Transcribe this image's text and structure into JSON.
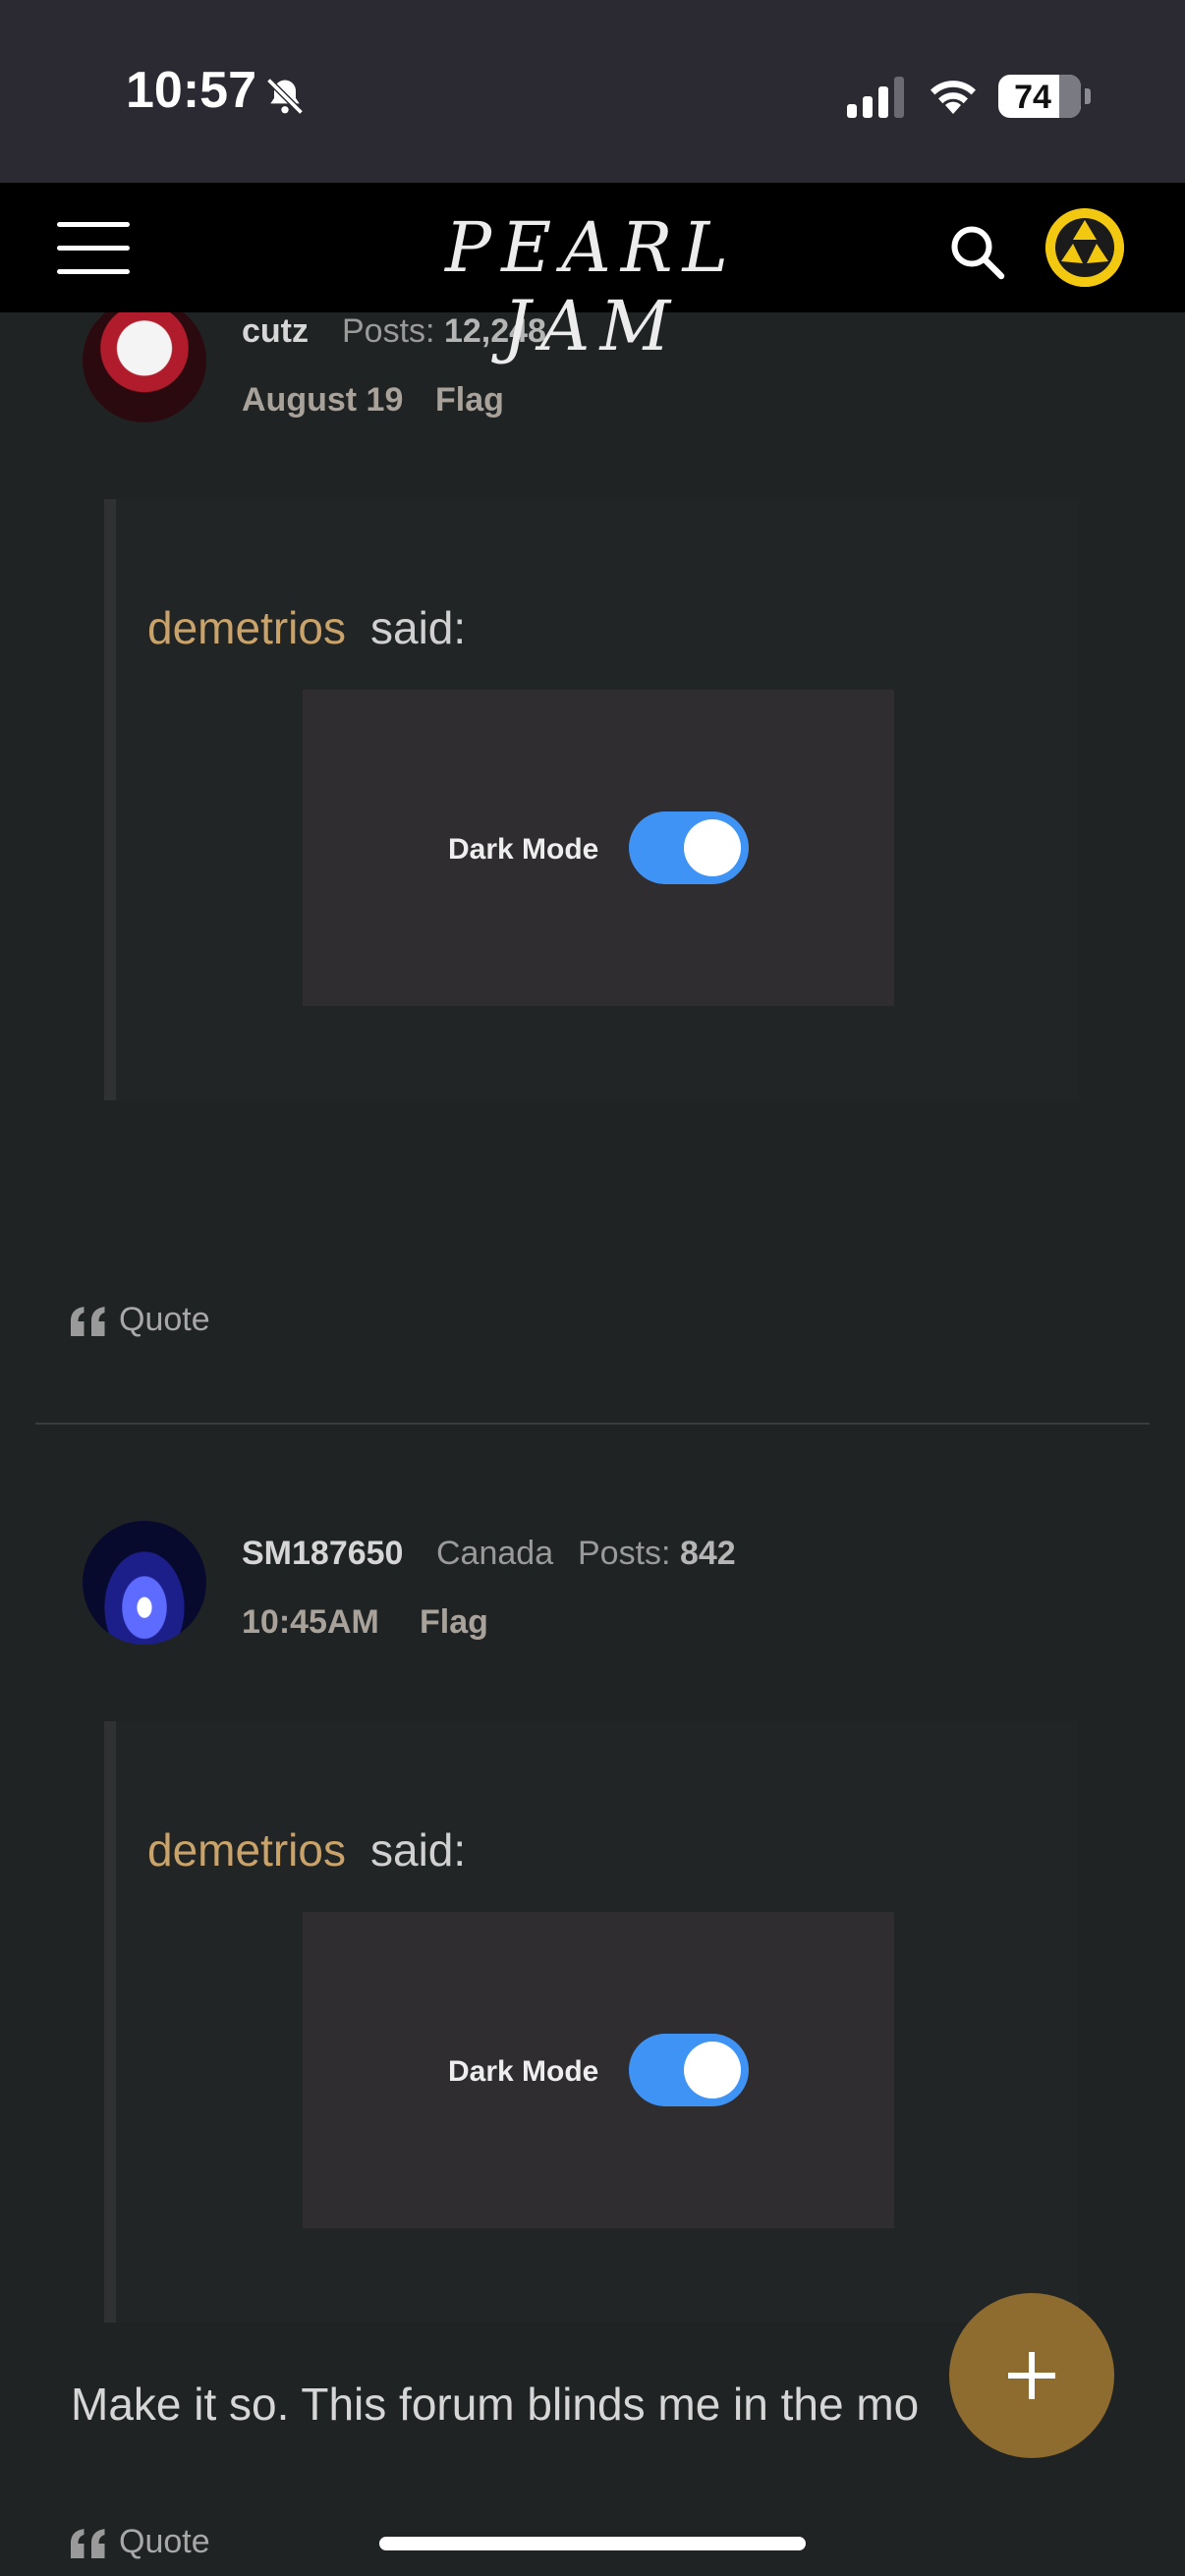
{
  "status_bar": {
    "time": "10:57",
    "battery": "74",
    "icons": [
      "bell-slash-icon",
      "signal-icon",
      "wifi-icon",
      "battery-icon"
    ]
  },
  "header": {
    "logo_text": "PEARL JAM",
    "menu_icon": "hamburger-menu-icon",
    "search_icon": "search-icon",
    "avatar_icon": "record-adapter-icon",
    "avatar_color": "#f2c811"
  },
  "posts": [
    {
      "username": "cutz",
      "location": "",
      "posts_label": "Posts:",
      "posts_count": "12,248",
      "date": "August 19",
      "flag_label": "Flag",
      "quote": {
        "author": "demetrios",
        "said": "said:",
        "image_label": "Dark Mode",
        "toggle_on": true
      },
      "body": "",
      "quote_action": "Quote"
    },
    {
      "username": "SM187650",
      "location": "Canada",
      "posts_label": "Posts:",
      "posts_count": "842",
      "date": "10:45AM",
      "flag_label": "Flag",
      "quote": {
        "author": "demetrios",
        "said": "said:",
        "image_label": "Dark Mode",
        "toggle_on": true
      },
      "body": "Make it so. This forum blinds me in the mo",
      "quote_action": "Quote"
    }
  ],
  "colors": {
    "accent_link": "#c9a36a",
    "fab": "#8e6b2f",
    "toggle": "#3f93f5",
    "background": "#202324"
  },
  "fab_icon": "plus-icon"
}
